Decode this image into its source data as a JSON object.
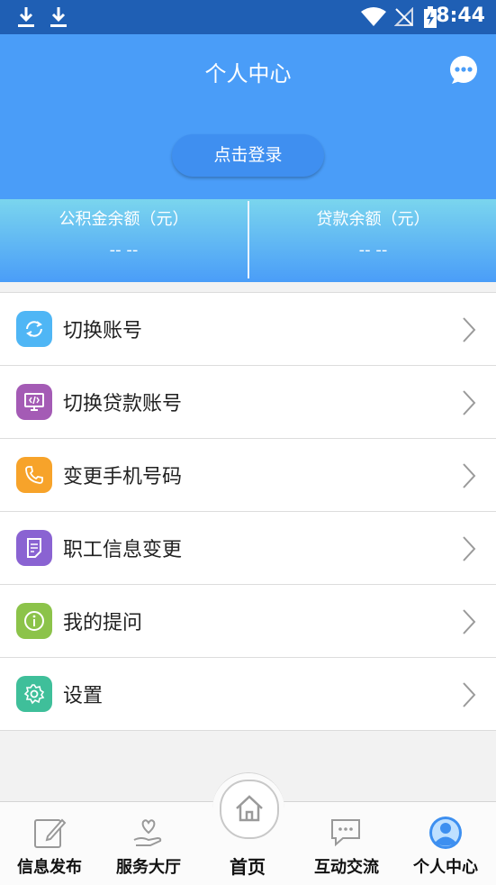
{
  "status_bar": {
    "time": "8:44"
  },
  "header": {
    "title": "个人中心",
    "login_label": "点击登录"
  },
  "balances": [
    {
      "label": "公积金余额（元）",
      "value": "-- --"
    },
    {
      "label": "贷款余额（元）",
      "value": "-- --"
    }
  ],
  "menu": [
    {
      "label": "切换账号",
      "icon": "switch-account-icon",
      "color": "#4fb6f5"
    },
    {
      "label": "切换贷款账号",
      "icon": "loan-account-icon",
      "color": "#a45bb5"
    },
    {
      "label": "变更手机号码",
      "icon": "phone-icon",
      "color": "#f7a32a"
    },
    {
      "label": "职工信息变更",
      "icon": "document-icon",
      "color": "#8a63d2"
    },
    {
      "label": "我的提问",
      "icon": "info-icon",
      "color": "#8cc34a"
    },
    {
      "label": "设置",
      "icon": "gear-icon",
      "color": "#3fbf9a"
    }
  ],
  "tabs": [
    {
      "label": "信息发布"
    },
    {
      "label": "服务大厅"
    },
    {
      "label": "首页"
    },
    {
      "label": "互动交流"
    },
    {
      "label": "个人中心"
    }
  ],
  "colors": {
    "header": "#4a9df8",
    "status_bar": "#1f5fb4",
    "active_tab": "#3d8ff0"
  }
}
